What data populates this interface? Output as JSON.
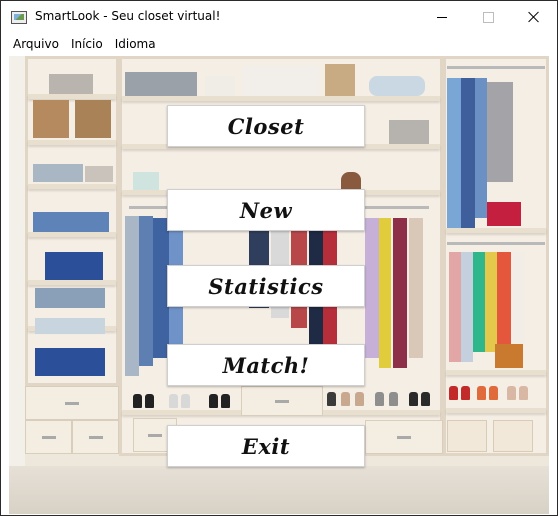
{
  "window": {
    "title": "SmartLook - Seu closet virtual!"
  },
  "menubar": {
    "items": [
      "Arquivo",
      "Início",
      "Idioma"
    ]
  },
  "buttons": {
    "closet": "Closet",
    "new": "New",
    "statistics": "Statistics",
    "match": "Match!",
    "exit": "Exit"
  },
  "icons": {
    "app": "image-icon",
    "minimize": "minimize-icon",
    "maximize": "maximize-icon",
    "close": "close-icon"
  },
  "background": {
    "subject": "wardrobe-closet-photo"
  }
}
